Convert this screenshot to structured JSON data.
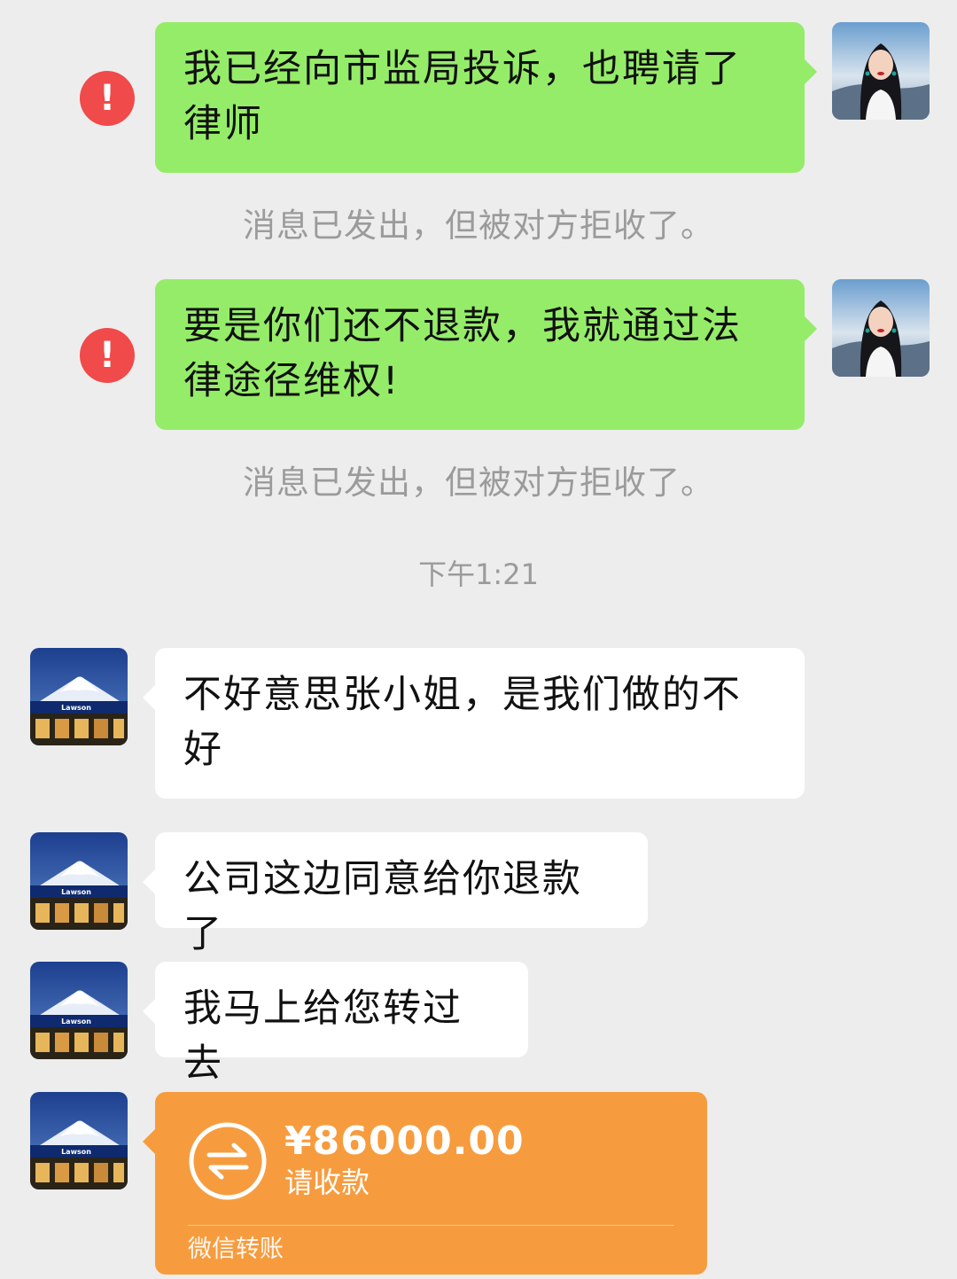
{
  "messages": {
    "sent_1": "我已经向市监局投诉，也聘请了律师",
    "sent_2": "要是你们还不退款，我就通过法律途径维权!",
    "recv_1": "不好意思张小姐，是我们做的不好",
    "recv_2": "公司这边同意给你退款了",
    "recv_3": "我马上给您转过去"
  },
  "error_mark": "!",
  "system": {
    "rejected_1": "消息已发出，但被对方拒收了。",
    "rejected_2": "消息已发出，但被对方拒收了。",
    "timestamp": "下午1:21"
  },
  "transfer": {
    "amount": "¥86000.00",
    "status": "请收款",
    "footer": "微信转账"
  },
  "avatars": {
    "other_store_sign": "Lawson"
  },
  "colors": {
    "chat_background": "#ededed",
    "sent_bubble": "#95ec69",
    "received_bubble": "#ffffff",
    "error_mark": "#f04a4a",
    "transfer_card": "#f79c3e",
    "system_text": "#9b9b9b"
  },
  "icons": {
    "error": "exclamation-circle-icon",
    "transfer": "transfer-arrows-icon"
  }
}
